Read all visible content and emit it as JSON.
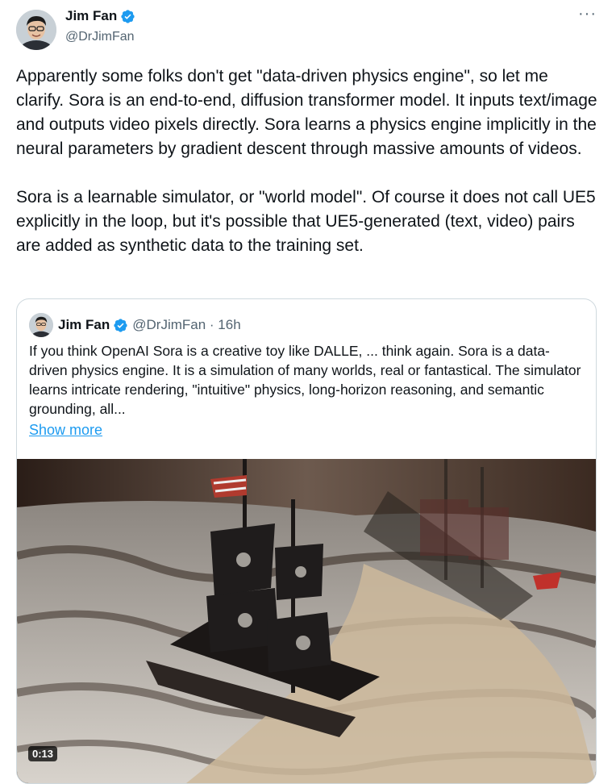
{
  "tweet": {
    "author": {
      "name": "Jim Fan",
      "handle": "@DrJimFan",
      "verified": true
    },
    "more_icon": "more-horizontal-icon",
    "text": "Apparently some folks don't get \"data-driven physics engine\", so let me clarify. Sora is an end-to-end, diffusion transformer model. It inputs text/image and outputs video pixels directly. Sora learns a physics engine implicitly in the neural parameters by gradient descent through massive amounts of videos.\n\nSora is a learnable simulator, or \"world model\". Of course it does not call UE5 explicitly in the loop, but it's possible that UE5-generated (text, video) pairs are added as synthetic data to the training set."
  },
  "quote": {
    "author": {
      "name": "Jim Fan",
      "handle": "@DrJimFan",
      "verified": true
    },
    "time": "16h",
    "meta": "@DrJimFan · 16h",
    "text": "If you think OpenAI Sora is a creative toy like DALLE, ... think again. Sora is a data-driven physics engine. It is a simulation of many worlds, real or fantastical. The simulator learns intricate rendering, \"intuitive\" physics, long-horizon reasoning, and semantic grounding, all...",
    "show_more": "Show more",
    "media": {
      "type": "video",
      "duration": "0:13"
    }
  },
  "colors": {
    "accent": "#1d9bf0",
    "text": "#0f1419",
    "secondary": "#536471",
    "border": "#cfd9de"
  }
}
